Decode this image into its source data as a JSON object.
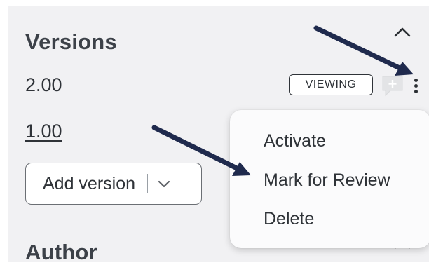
{
  "versions_section": {
    "title": "Versions",
    "items": [
      {
        "label": "2.00",
        "badge": "VIEWING"
      },
      {
        "label": "1.00"
      }
    ],
    "add_button_label": "Add version"
  },
  "context_menu": {
    "items": [
      "Activate",
      "Mark for Review",
      "Delete"
    ]
  },
  "author_section": {
    "title": "Author"
  },
  "icons": {
    "collapse": "chevron-up-icon",
    "comment": "add-comment-icon",
    "more": "kebab-menu-icon",
    "dropdown": "chevron-down-icon"
  },
  "colors": {
    "panel_bg": "#f1f1f3",
    "annotation_arrow": "#1f2a4d"
  }
}
